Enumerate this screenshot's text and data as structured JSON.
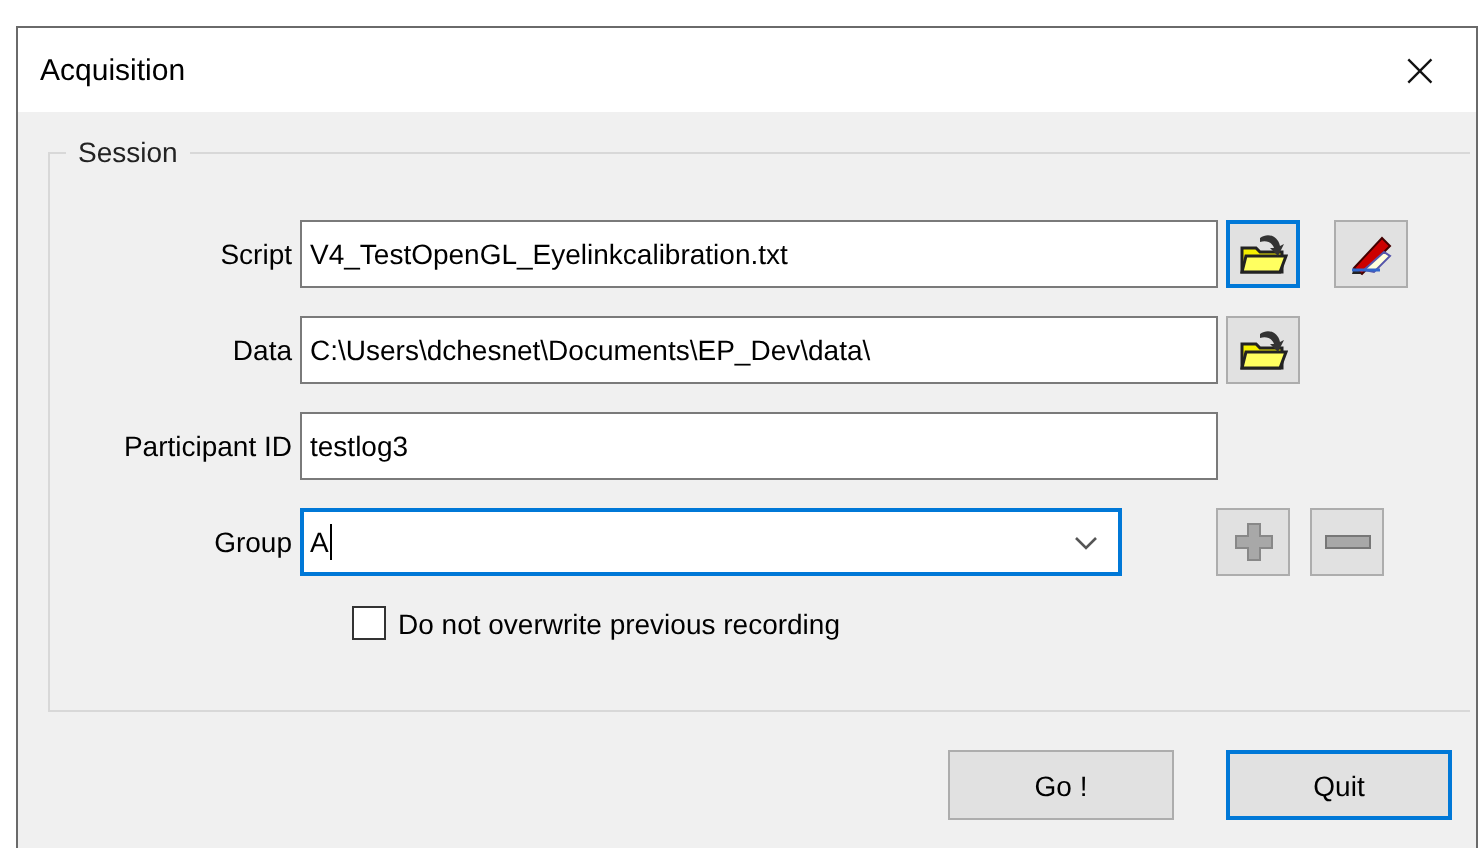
{
  "window": {
    "title": "Acquisition",
    "close": "×"
  },
  "session": {
    "legend": "Session",
    "fields": [
      {
        "kind": "text",
        "label": "Script",
        "value": "V4_TestOpenGL_Eyelinkcalibration.txt",
        "focused": false,
        "buttons": [
          {
            "kind": "folder",
            "focused": true
          },
          {
            "kind": "edit",
            "focused": false
          }
        ]
      },
      {
        "kind": "text",
        "label": "Data",
        "value": "C:\\Users\\dchesnet\\Documents\\EP_Dev\\data\\",
        "focused": false,
        "buttons": [
          {
            "kind": "folder",
            "focused": false
          }
        ]
      },
      {
        "kind": "text",
        "label": "Participant ID",
        "value": "testlog3",
        "focused": false
      },
      {
        "kind": "combo",
        "label": "Group",
        "value": "A",
        "focused": true,
        "buttons": [
          {
            "kind": "add",
            "focused": false
          },
          {
            "kind": "remove",
            "focused": false
          }
        ]
      }
    ],
    "checkbox": {
      "label": "Do not overwrite previous recording",
      "checked": false
    }
  },
  "buttons": [
    {
      "label": "Go !",
      "focused": false
    },
    {
      "label": "Quit",
      "focused": true
    }
  ]
}
